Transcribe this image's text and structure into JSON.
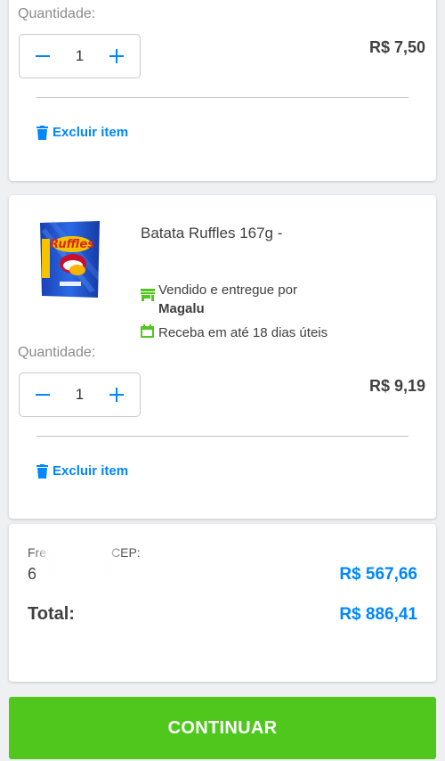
{
  "item1": {
    "quantity_label": "Quantidade:",
    "quantity": "1",
    "price": "R$ 7,50",
    "remove_label": "Excluir item"
  },
  "item2": {
    "name": "Batata Ruffles 167g -",
    "sold_by_label": "Vendido e entregue por",
    "seller": "Magalu",
    "delivery": "Receba em até 18 dias úteis",
    "quantity_label": "Quantidade:",
    "quantity": "1",
    "price": "R$ 9,19",
    "remove_label": "Excluir item"
  },
  "summary": {
    "freight_label_partial": "Fre",
    "freight_label_partial2": "CEP:",
    "cep_partial": "6",
    "freight_value": "R$ 567,66",
    "total_label": "Total:",
    "total_value": "R$ 886,41"
  },
  "continue_label": "CONTINUAR",
  "colors": {
    "accent_blue": "#0086ff",
    "button_green": "#4fc71d",
    "icon_green": "#4fc71d"
  }
}
